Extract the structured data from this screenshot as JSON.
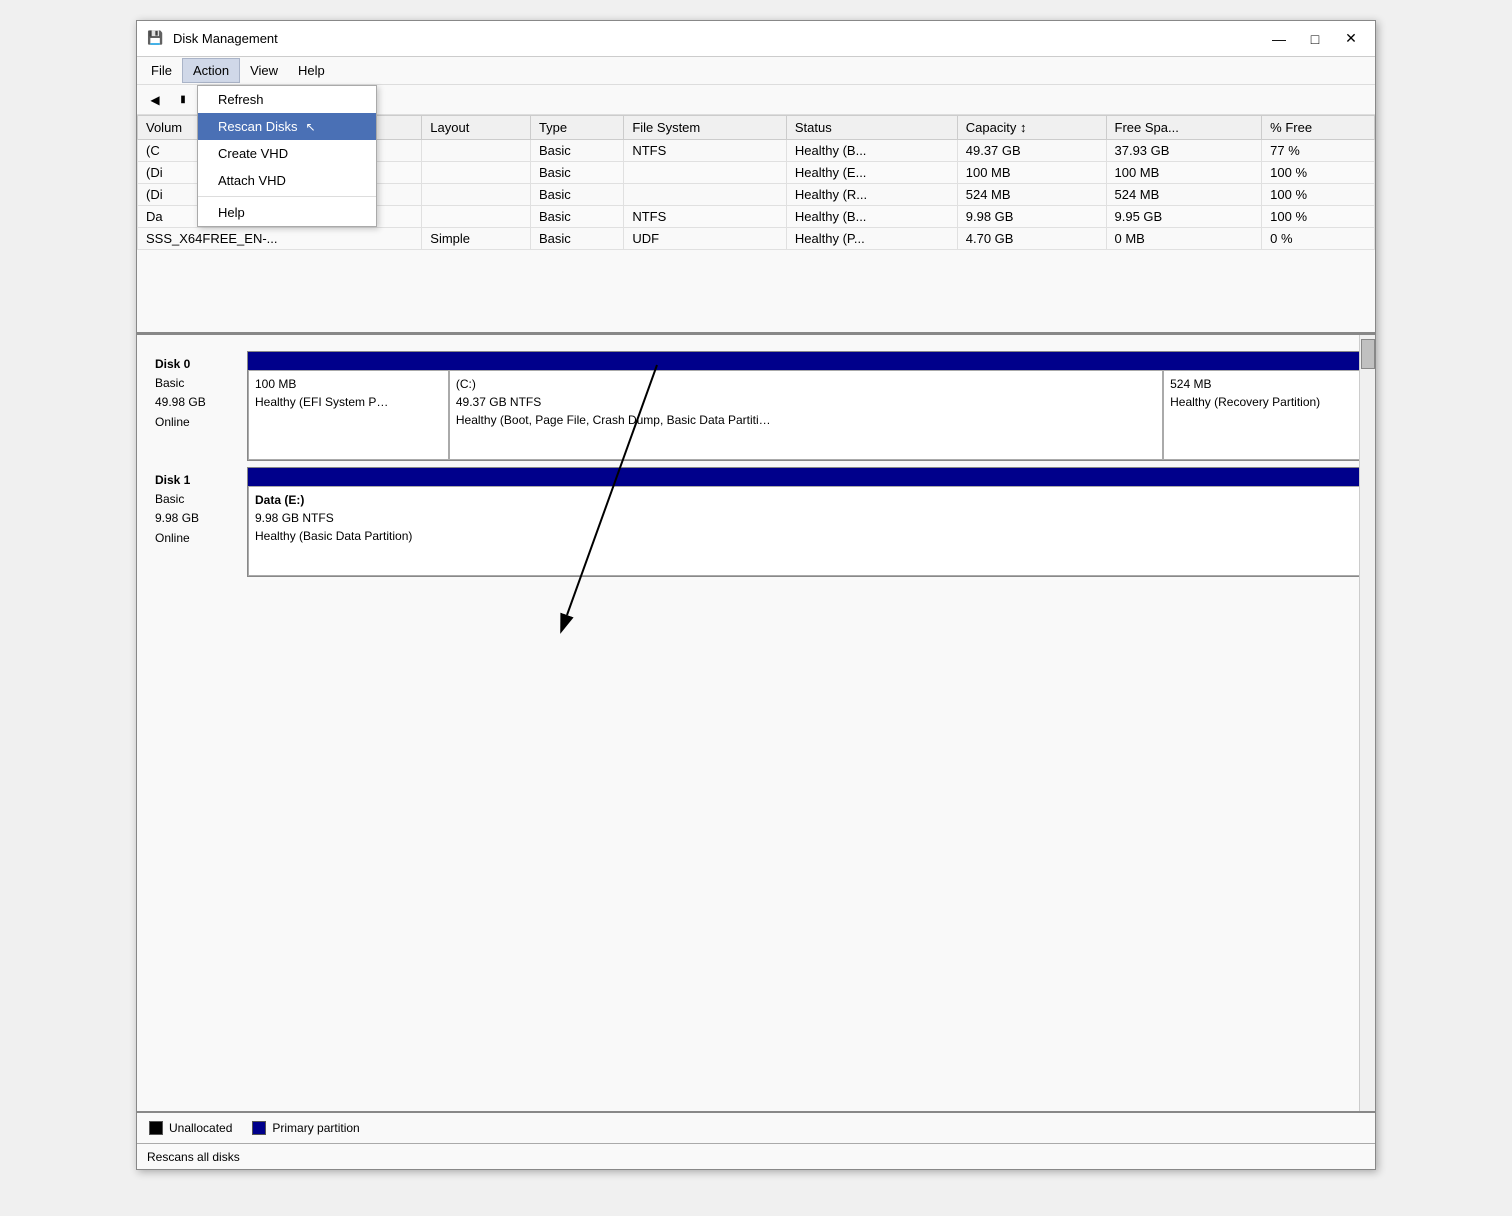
{
  "window": {
    "title": "Disk Management",
    "icon": "💾"
  },
  "titleControls": {
    "minimize": "—",
    "maximize": "□",
    "close": "✕"
  },
  "menuBar": {
    "items": [
      {
        "id": "file",
        "label": "File"
      },
      {
        "id": "action",
        "label": "Action",
        "active": true
      },
      {
        "id": "view",
        "label": "View"
      },
      {
        "id": "help",
        "label": "Help"
      }
    ]
  },
  "dropdownMenu": {
    "items": [
      {
        "id": "refresh",
        "label": "Refresh",
        "highlighted": false
      },
      {
        "id": "rescan",
        "label": "Rescan Disks",
        "highlighted": true
      },
      {
        "id": "create-vhd",
        "label": "Create VHD",
        "highlighted": false
      },
      {
        "id": "attach-vhd",
        "label": "Attach VHD",
        "highlighted": false
      },
      {
        "id": "help",
        "label": "Help",
        "highlighted": false
      }
    ]
  },
  "toolbar": {
    "backLabel": "←",
    "fwdLabel": "→"
  },
  "table": {
    "columns": [
      "Volume",
      "Layout",
      "Type",
      "File System",
      "Status",
      "Capacity",
      "Free Spa...",
      "% Free"
    ],
    "rows": [
      {
        "volume": "(C",
        "layout": "",
        "type": "Basic",
        "fs": "NTFS",
        "status": "Healthy (B...",
        "capacity": "49.37 GB",
        "free": "37.93 GB",
        "pctFree": "77 %"
      },
      {
        "volume": "(Di",
        "layout": "",
        "type": "Basic",
        "fs": "",
        "status": "Healthy (E...",
        "capacity": "100 MB",
        "free": "100 MB",
        "pctFree": "100 %"
      },
      {
        "volume": "(Di",
        "layout": "",
        "type": "Basic",
        "fs": "",
        "status": "Healthy (R...",
        "capacity": "524 MB",
        "free": "524 MB",
        "pctFree": "100 %"
      },
      {
        "volume": "Da",
        "layout": "",
        "type": "Basic",
        "fs": "NTFS",
        "status": "Healthy (B...",
        "capacity": "9.98 GB",
        "free": "9.95 GB",
        "pctFree": "100 %"
      },
      {
        "volume": "SSS_X64FREE_EN-...",
        "layout": "Simple",
        "type": "Basic",
        "fs": "UDF",
        "status": "Healthy (P...",
        "capacity": "4.70 GB",
        "free": "0 MB",
        "pctFree": "0 %"
      }
    ]
  },
  "disks": [
    {
      "name": "Disk 0",
      "type": "Basic",
      "size": "49.98 GB",
      "state": "Online",
      "partitions": [
        {
          "label": "",
          "size": "100 MB",
          "desc": "Healthy (EFI System P…",
          "widthPct": 18,
          "bold": false
        },
        {
          "label": "(C:)",
          "size": "49.37 GB NTFS",
          "desc": "Healthy (Boot, Page File, Crash Dump, Basic Data Partiti…",
          "widthPct": 64,
          "bold": false
        },
        {
          "label": "",
          "size": "524 MB",
          "desc": "Healthy (Recovery Partition)",
          "widthPct": 18,
          "bold": false
        }
      ]
    },
    {
      "name": "Disk 1",
      "type": "Basic",
      "size": "9.98 GB",
      "state": "Online",
      "partitions": [
        {
          "label": "Data  (E:)",
          "size": "9.98 GB NTFS",
          "desc": "Healthy (Basic Data Partition)",
          "widthPct": 100,
          "bold": true
        }
      ]
    }
  ],
  "legend": {
    "unallocated": {
      "label": "Unallocated",
      "color": "#000000"
    },
    "primaryPartition": {
      "label": "Primary partition",
      "color": "#00008b"
    }
  },
  "statusBar": {
    "text": "Rescans all disks"
  }
}
